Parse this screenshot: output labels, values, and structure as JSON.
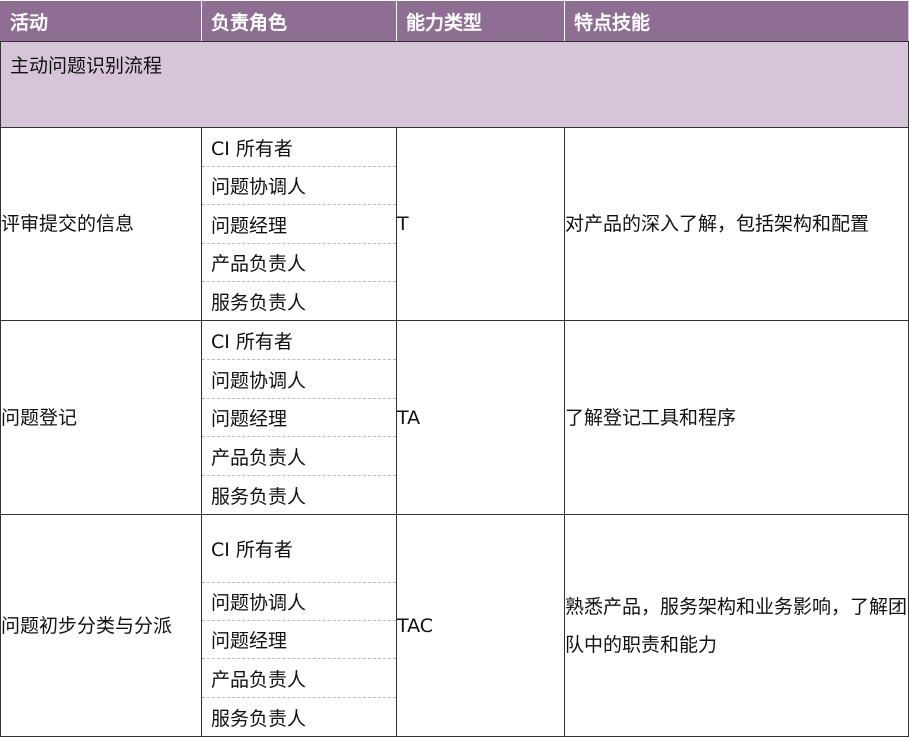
{
  "headers": {
    "activity": "活动",
    "role": "负责角色",
    "ability": "能力类型",
    "skill": "特点技能"
  },
  "section_title": "主动问题识别流程",
  "rows": [
    {
      "activity": "评审提交的信息",
      "roles": [
        "CI 所有者",
        "问题协调人",
        "问题经理",
        "产品负责人",
        "服务负责人"
      ],
      "ability": "T",
      "skill": "对产品的深入了解，包括架构和配置"
    },
    {
      "activity": "问题登记",
      "roles": [
        "CI 所有者",
        "问题协调人",
        "问题经理",
        "产品负责人",
        "服务负责人"
      ],
      "ability": "TA",
      "skill": "了解登记工具和程序"
    },
    {
      "activity": "问题初步分类与分派",
      "roles": [
        "CI 所有者",
        "问题协调人",
        "问题经理",
        "产品负责人",
        "服务负责人"
      ],
      "ability": "TAC",
      "skill": "熟悉产品，服务架构和业务影响，了解团队中的职责和能力"
    }
  ]
}
